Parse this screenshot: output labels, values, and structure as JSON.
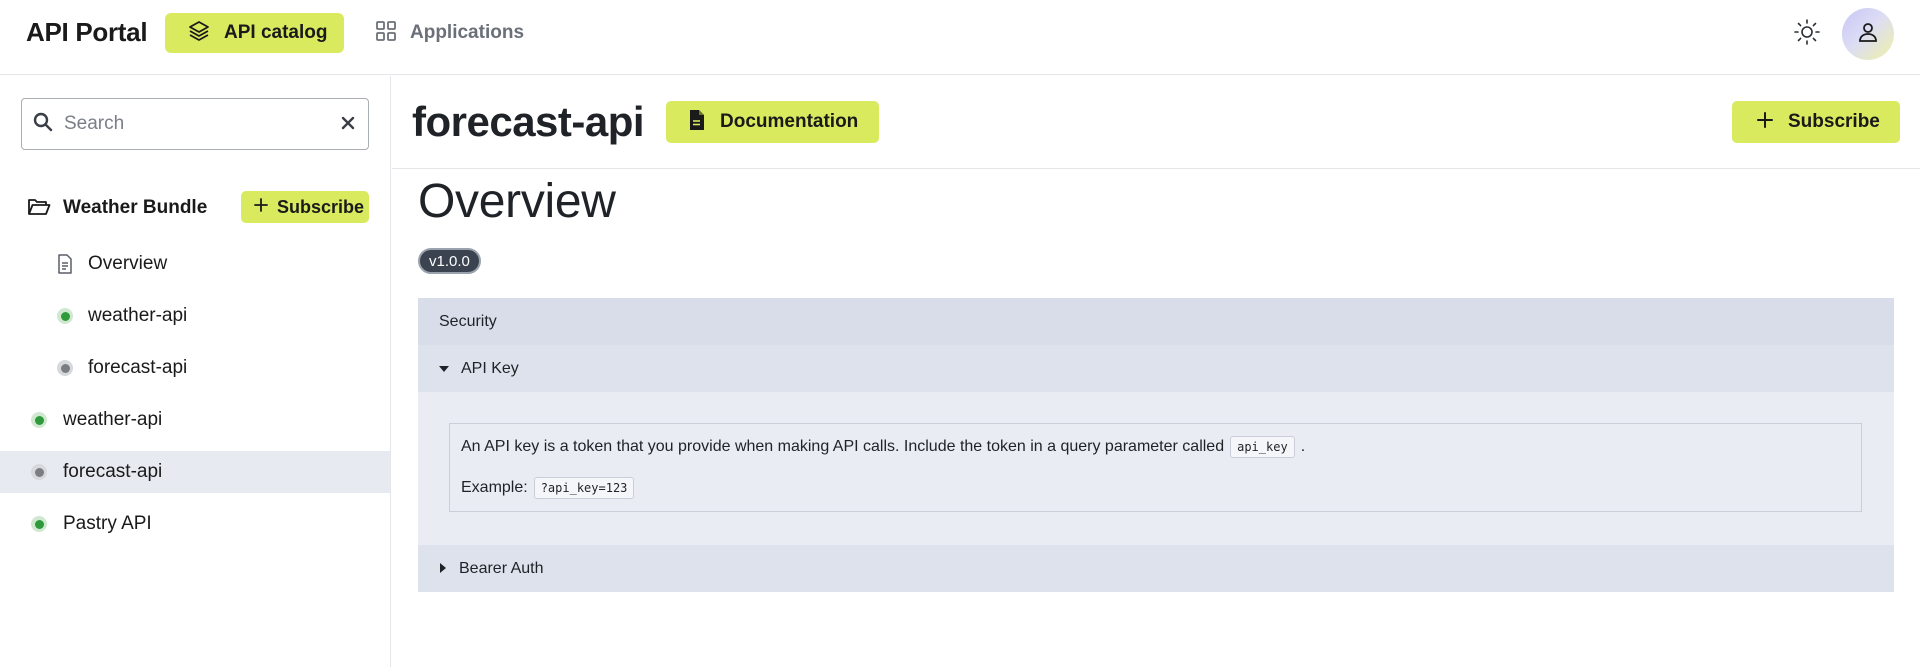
{
  "brand": "API Portal",
  "nav": {
    "api_catalog": "API catalog",
    "applications": "Applications"
  },
  "search": {
    "placeholder": "Search",
    "value": ""
  },
  "sidebar": {
    "bundle_name": "Weather Bundle",
    "bundle_subscribe": "Subscribe",
    "children": [
      {
        "label": "Overview",
        "icon": "document-icon"
      },
      {
        "label": "weather-api",
        "status": "green"
      },
      {
        "label": "forecast-api",
        "status": "gray"
      }
    ],
    "items": [
      {
        "label": "weather-api",
        "status": "green"
      },
      {
        "label": "forecast-api",
        "status": "gray",
        "selected": true
      },
      {
        "label": "Pastry API",
        "status": "green"
      }
    ]
  },
  "main": {
    "api_title": "forecast-api",
    "documentation_label": "Documentation",
    "subscribe_label": "Subscribe",
    "overview_title": "Overview",
    "version": "v1.0.0",
    "security": {
      "header": "Security",
      "api_key": {
        "title": "API Key",
        "description": "An API key is a token that you provide when making API calls. Include the token in a query parameter called",
        "param_name": "api_key",
        "description_end": ".",
        "example_label": "Example:",
        "example_value": "?api_key=123"
      },
      "bearer_title": "Bearer Auth"
    }
  },
  "colors": {
    "accent": "#d9ea5f",
    "status_green": "#2f9a3b",
    "status_gray": "#7a7d82",
    "selected_bg": "#e8eaf2",
    "security_bg": "#e9ecf3"
  }
}
